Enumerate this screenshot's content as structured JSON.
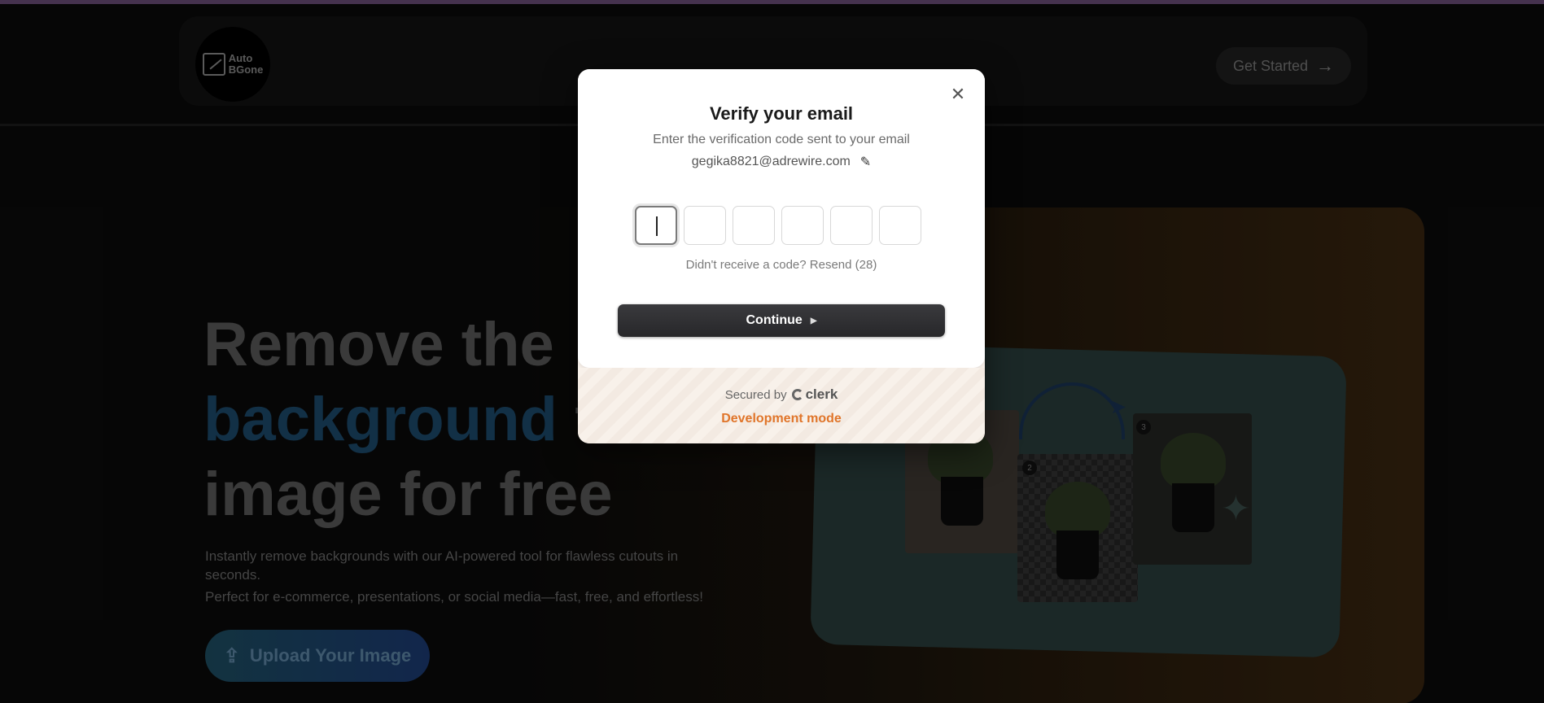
{
  "background": {
    "logo_text_line1": "Auto",
    "logo_text_line2": "BGone",
    "get_started_label": "Get Started",
    "hero_title_line1": "Remove the",
    "hero_title_highlight": "background",
    "hero_title_line2_rest": " from",
    "hero_title_line3": "image for free",
    "hero_desc_line1": "Instantly remove backgrounds with our AI-powered tool for flawless cutouts in seconds.",
    "hero_desc_line2": "Perfect for e-commerce, presentations, or social media—fast, free, and effortless!",
    "upload_label": "Upload Your Image",
    "step2": "2",
    "step3": "3"
  },
  "modal": {
    "title": "Verify your email",
    "subtitle": "Enter the verification code sent to your email",
    "email": "gegika8821@adrewire.com",
    "code_digits": [
      "",
      "",
      "",
      "",
      "",
      ""
    ],
    "resend_text": "Didn't receive a code? Resend (28)",
    "continue_label": "Continue",
    "secured_by": "Secured by",
    "clerk_brand": "clerk",
    "dev_mode": "Development mode"
  },
  "colors": {
    "accent_dev": "#e0752a",
    "button_dark": "#27272a",
    "hero_highlight": "#1d4a6c"
  }
}
